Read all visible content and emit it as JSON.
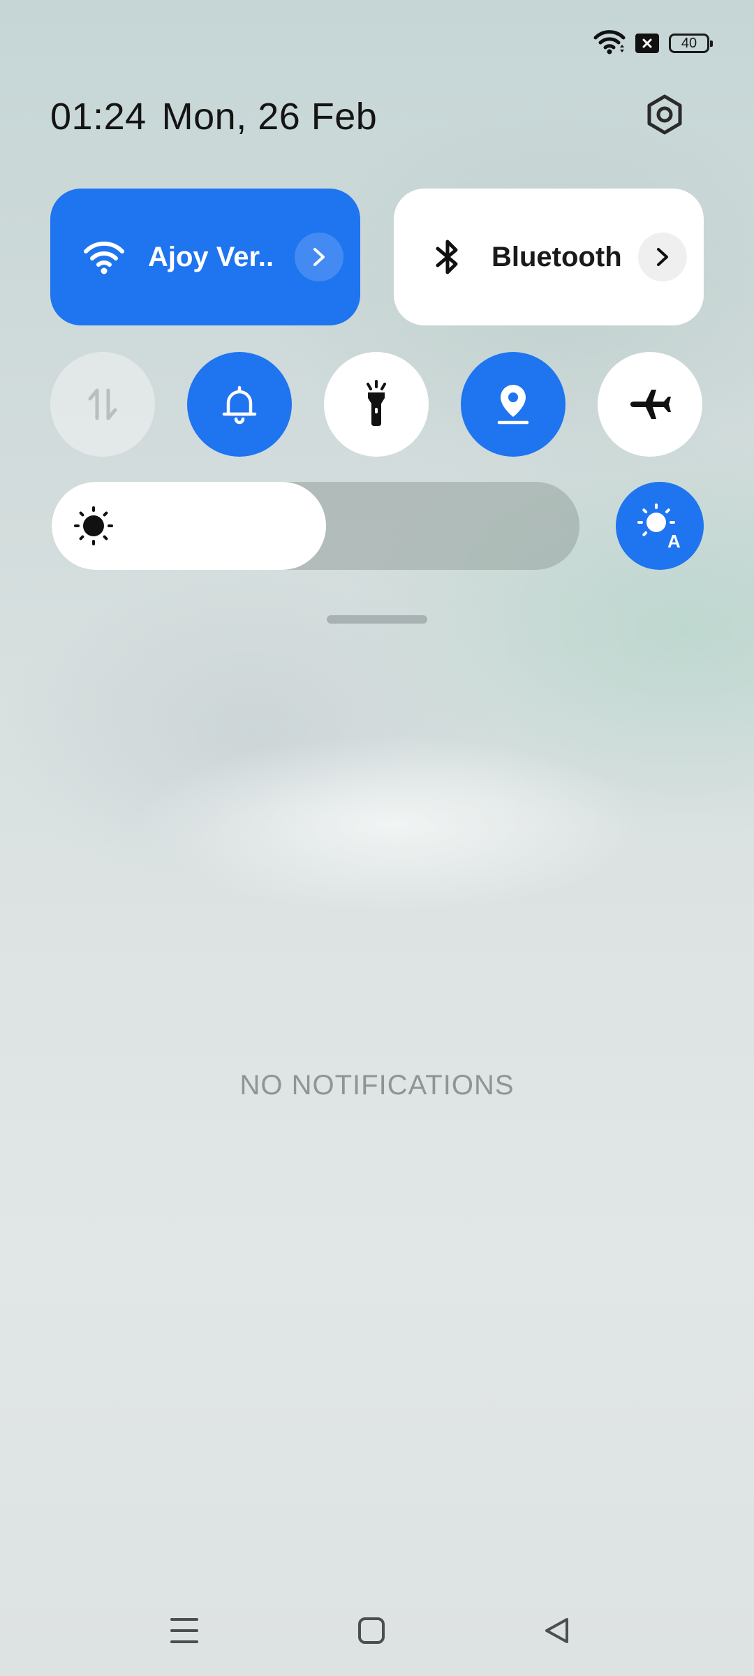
{
  "status_bar": {
    "battery_level": "40",
    "icons": [
      "wifi-icon",
      "no-sim-icon",
      "battery-icon"
    ]
  },
  "header": {
    "time": "01:24",
    "date": "Mon, 26 Feb",
    "settings_icon": "settings-icon"
  },
  "quick_tiles": {
    "wifi": {
      "label": "Ajoy Ver..",
      "active": true,
      "icon": "wifi-icon"
    },
    "bluetooth": {
      "label": "Bluetooth",
      "active": false,
      "icon": "bluetooth-icon"
    }
  },
  "toggles": [
    {
      "name": "mobile-data",
      "icon": "mobile-data-icon",
      "active": false
    },
    {
      "name": "sound",
      "icon": "bell-icon",
      "active": true
    },
    {
      "name": "torch",
      "icon": "flashlight-icon",
      "active": false
    },
    {
      "name": "location",
      "icon": "location-icon",
      "active": true
    },
    {
      "name": "airplane-mode",
      "icon": "airplane-icon",
      "active": false
    }
  ],
  "brightness": {
    "level_fraction": 0.52,
    "auto": true,
    "auto_icon": "auto-brightness-icon"
  },
  "notifications": {
    "empty_text": "NO NOTIFICATIONS"
  },
  "nav_bar": {
    "icons": [
      "menu-icon",
      "home-icon",
      "back-icon"
    ]
  },
  "colors": {
    "accent": "#1f74f0",
    "tile_inactive": "#ffffff",
    "text_muted": "#8f9596"
  }
}
